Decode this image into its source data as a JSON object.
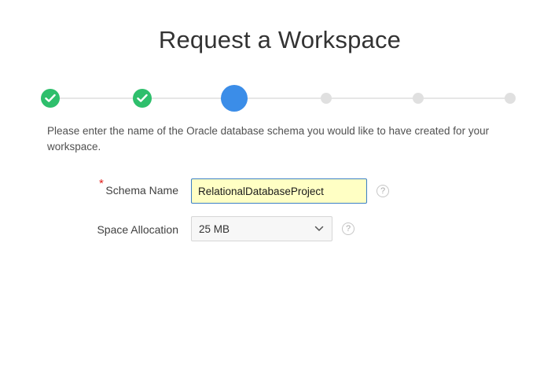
{
  "page": {
    "title": "Request a Workspace",
    "instructions": "Please enter the name of the Oracle database schema you would like to have created for your workspace."
  },
  "wizard": {
    "steps": [
      {
        "state": "completed"
      },
      {
        "state": "completed"
      },
      {
        "state": "current"
      },
      {
        "state": "pending"
      },
      {
        "state": "pending"
      },
      {
        "state": "pending"
      }
    ],
    "colors": {
      "completed": "#2ebf6c",
      "current": "#3b8de8",
      "pending": "#e0e0e0"
    }
  },
  "form": {
    "schema_name": {
      "required_marker": "*",
      "label": "Schema Name",
      "value": "RelationalDatabaseProject",
      "help_glyph": "?"
    },
    "space_allocation": {
      "label": "Space Allocation",
      "selected": "25 MB",
      "help_glyph": "?"
    }
  }
}
